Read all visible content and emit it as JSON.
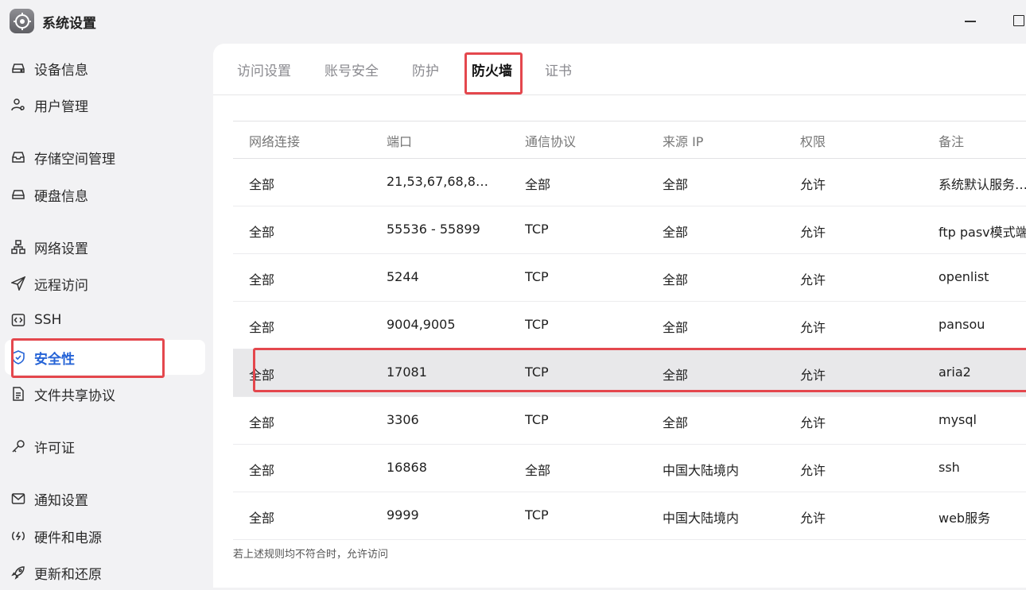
{
  "window": {
    "title": "系统设置"
  },
  "sidebar": {
    "items": [
      {
        "label": "设备信息",
        "icon": "drive-icon"
      },
      {
        "label": "用户管理",
        "icon": "user-gear-icon"
      },
      {
        "label": "存储空间管理",
        "icon": "tray-icon"
      },
      {
        "label": "硬盘信息",
        "icon": "disk-icon"
      },
      {
        "label": "网络设置",
        "icon": "network-icon"
      },
      {
        "label": "远程访问",
        "icon": "send-icon"
      },
      {
        "label": "SSH",
        "icon": "code-icon"
      },
      {
        "label": "安全性",
        "icon": "shield-check-icon",
        "active": true
      },
      {
        "label": "文件共享协议",
        "icon": "document-icon"
      },
      {
        "label": "许可证",
        "icon": "key-icon"
      },
      {
        "label": "通知设置",
        "icon": "mail-icon"
      },
      {
        "label": "硬件和电源",
        "icon": "power-icon"
      },
      {
        "label": "更新和还原",
        "icon": "rocket-icon"
      }
    ]
  },
  "tabs": [
    {
      "label": "访问设置"
    },
    {
      "label": "账号安全"
    },
    {
      "label": "防护"
    },
    {
      "label": "防火墙",
      "active": true
    },
    {
      "label": "证书"
    }
  ],
  "table": {
    "columns": [
      "网络连接",
      "端口",
      "通信协议",
      "来源 IP",
      "权限",
      "备注"
    ],
    "rows": [
      [
        "全部",
        "21,53,67,68,8…",
        "全部",
        "全部",
        "允许",
        "系统默认服务…"
      ],
      [
        "全部",
        "55536 - 55899",
        "TCP",
        "全部",
        "允许",
        "ftp pasv模式端"
      ],
      [
        "全部",
        "5244",
        "TCP",
        "全部",
        "允许",
        "openlist"
      ],
      [
        "全部",
        "9004,9005",
        "TCP",
        "全部",
        "允许",
        "pansou"
      ],
      [
        "全部",
        "17081",
        "TCP",
        "全部",
        "允许",
        "aria2"
      ],
      [
        "全部",
        "3306",
        "TCP",
        "全部",
        "允许",
        "mysql"
      ],
      [
        "全部",
        "16868",
        "全部",
        "中国大陆境内",
        "允许",
        "ssh"
      ],
      [
        "全部",
        "9999",
        "TCP",
        "中国大陆境内",
        "允许",
        "web服务"
      ]
    ],
    "highlighted_row": 4,
    "footnote": "若上述规则均不符合时，允许访问"
  },
  "colors": {
    "accent": "#2563d6",
    "annotation": "#e4474d",
    "sidebar_bg": "#f2f2f4"
  }
}
